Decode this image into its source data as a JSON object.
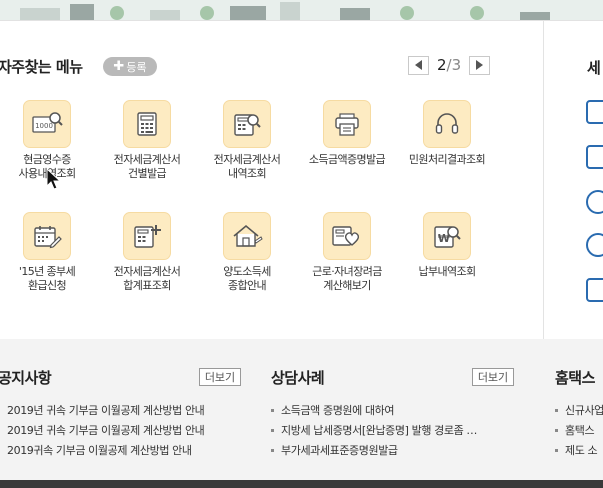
{
  "favorites": {
    "title": "자주찾는 메뉴",
    "register_label": "등록",
    "pager": {
      "current": "2",
      "separator": "/",
      "total": "3"
    },
    "items": [
      {
        "label": "현금영수증\n사용내역조회",
        "icon": "receipt-search-icon"
      },
      {
        "label": "전자세금계산서\n건별발급",
        "icon": "invoice-calculator-icon"
      },
      {
        "label": "전자세금계산서\n내역조회",
        "icon": "invoice-search-icon"
      },
      {
        "label": "소득금액증명발급",
        "icon": "printer-icon"
      },
      {
        "label": "민원처리결과조회",
        "icon": "headset-icon"
      },
      {
        "label": "'15년 종부세\n환급신청",
        "icon": "calendar-edit-icon"
      },
      {
        "label": "전자세금계산서\n합계표조회",
        "icon": "invoice-sum-icon"
      },
      {
        "label": "양도소득세\n종합안내",
        "icon": "house-icon"
      },
      {
        "label": "근로·자녀장려금\n계산해보기",
        "icon": "hand-heart-icon"
      },
      {
        "label": "납부내역조회",
        "icon": "won-search-icon"
      }
    ]
  },
  "right_column": {
    "title": "세"
  },
  "notices": {
    "title": "공지사항",
    "more_label": "더보기",
    "items": [
      "2019년 귀속 기부금 이월공제 계산방법 안내",
      "2019년 귀속 기부금 이월공제 계산방법 안내",
      "2019귀속 기부금 이월공제 계산방법 안내"
    ]
  },
  "consult": {
    "title": "상담사례",
    "more_label": "더보기",
    "items": [
      "소득금액 증명원에 대하여",
      "지방세 납세증명서[완납증명] 발행 경로좀 …",
      "부가세과세표준증명원발급"
    ]
  },
  "hometax": {
    "title": "홈택스",
    "items": [
      "신규사업",
      "홈택스",
      "제도 소"
    ]
  },
  "colors": {
    "icon_bg": "#fdebc2",
    "accent_blue": "#2a6bb0",
    "bottom_bg": "#f3f3f3"
  }
}
